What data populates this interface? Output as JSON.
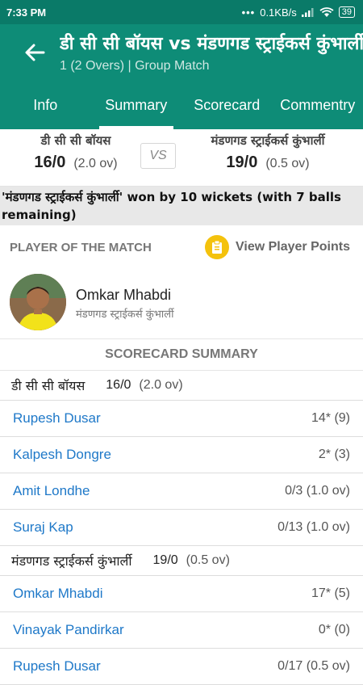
{
  "status_bar": {
    "time": "7:33 PM",
    "dots": "•••",
    "speed": "0.1KB/s",
    "battery": "39"
  },
  "header": {
    "title": "डी सी सी बॉयस vs मंडणगड स्ट्राईकर्स कुंभार्ली",
    "subtitle": "1 (2 Overs) | Group Match",
    "tabs": [
      "Info",
      "Summary",
      "Scorecard",
      "Commentry"
    ],
    "active_tab": "Summary"
  },
  "match": {
    "team1": {
      "name": "डी सी सी बॉयस",
      "score": "16/0",
      "overs": "(2.0 ov)"
    },
    "vs": "VS",
    "team2": {
      "name": "मंडणगड स्ट्राईकर्स कुंभार्ली",
      "score": "19/0",
      "overs": "(0.5 ov)"
    },
    "result": "'मंडणगड स्ट्राईकर्स कुंभार्ली' won by 10 wickets (with 7 balls remaining)"
  },
  "potm": {
    "label": "PLAYER OF THE MATCH",
    "view_points": "View Player Points",
    "player_name": "Omkar Mhabdi",
    "player_team": "मंडणगड स्ट्राईकर्स कुंभार्ली"
  },
  "scorecard": {
    "title": "SCORECARD  SUMMARY",
    "innings": [
      {
        "team": "डी सी सी बॉयस",
        "score": "16/0",
        "overs": "(2.0 ov)",
        "rows": [
          {
            "name": "Rupesh Dusar",
            "stat": "14* (9)"
          },
          {
            "name": "Kalpesh Dongre",
            "stat": "2* (3)"
          },
          {
            "name": "Amit Londhe",
            "stat": "0/3 (1.0 ov)"
          },
          {
            "name": "Suraj Kap",
            "stat": "0/13 (1.0 ov)"
          }
        ]
      },
      {
        "team": "मंडणगड स्ट्राईकर्स कुंभार्ली",
        "score": "19/0",
        "overs": "(0.5 ov)",
        "rows": [
          {
            "name": "Omkar Mhabdi",
            "stat": "17* (5)"
          },
          {
            "name": "Vinayak Pandirkar",
            "stat": "0* (0)"
          },
          {
            "name": "Rupesh Dusar",
            "stat": "0/17 (0.5 ov)"
          }
        ]
      }
    ]
  },
  "colors": {
    "appbar": "#0e8c77",
    "statusbar": "#0a7a68",
    "link": "#1e78c8",
    "badge": "#f4c20d"
  }
}
